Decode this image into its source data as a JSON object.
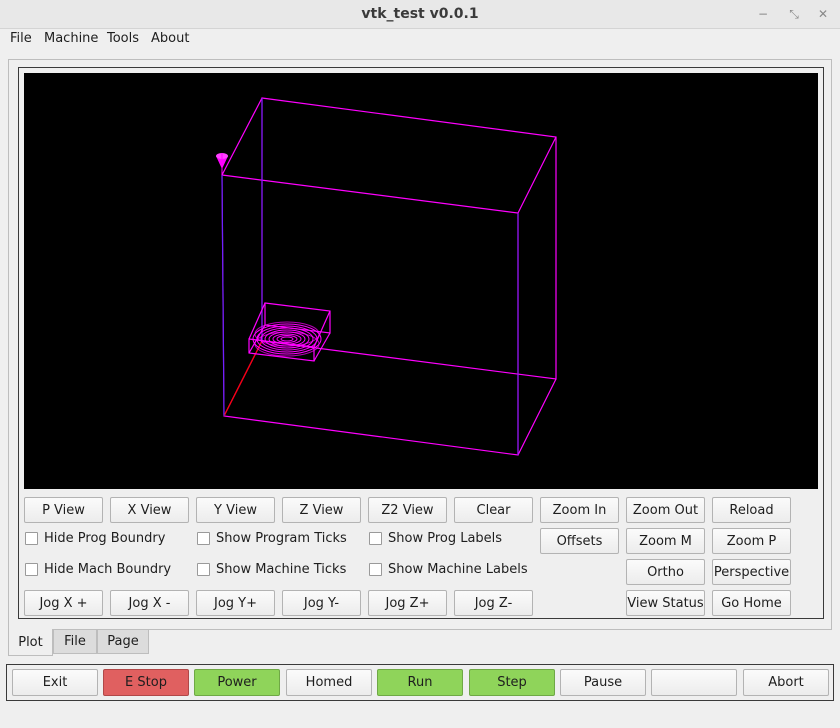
{
  "window": {
    "title": "vtk_test v0.0.1",
    "controls": {
      "minimize": "−",
      "restore": "⤡",
      "close": "✕"
    }
  },
  "menubar": {
    "items": [
      "File",
      "Machine",
      "Tools",
      "About"
    ]
  },
  "plot": {
    "view_buttons": [
      "P View",
      "X View",
      "Y View",
      "Z View",
      "Z2 View",
      "Clear",
      "Zoom In",
      "Zoom Out",
      "Reload"
    ],
    "checkboxes_row1": [
      "Hide Prog Boundry",
      "Show Program Ticks",
      "Show Prog Labels"
    ],
    "row1_buttons": [
      "Offsets",
      "Zoom M",
      "Zoom P"
    ],
    "checkboxes_row2": [
      "Hide Mach Boundry",
      "Show Machine Ticks",
      "Show Machine Labels"
    ],
    "row2_buttons": [
      "Ortho",
      "Perspective"
    ],
    "jog_buttons": [
      "Jog X +",
      "Jog X -",
      "Jog Y+",
      "Jog Y-",
      "Jog Z+",
      "Jog Z-"
    ],
    "row3_buttons": [
      "View Status",
      "Go Home"
    ],
    "colors": {
      "viewport_bg": "#000000",
      "boundary": "#ff00ff",
      "axis_x": "#ff0000",
      "axis_y": "#0000ff"
    }
  },
  "tabs": [
    "Plot",
    "File",
    "Page"
  ],
  "bottom": {
    "exit": "Exit",
    "estop": "E Stop",
    "power": "Power",
    "homed": "Homed",
    "run": "Run",
    "step": "Step",
    "pause": "Pause",
    "blank": "",
    "abort": "Abort",
    "colors": {
      "estop": "#e06060",
      "power": "#8fd45a",
      "run": "#8fd45a",
      "step": "#8fd45a"
    }
  }
}
